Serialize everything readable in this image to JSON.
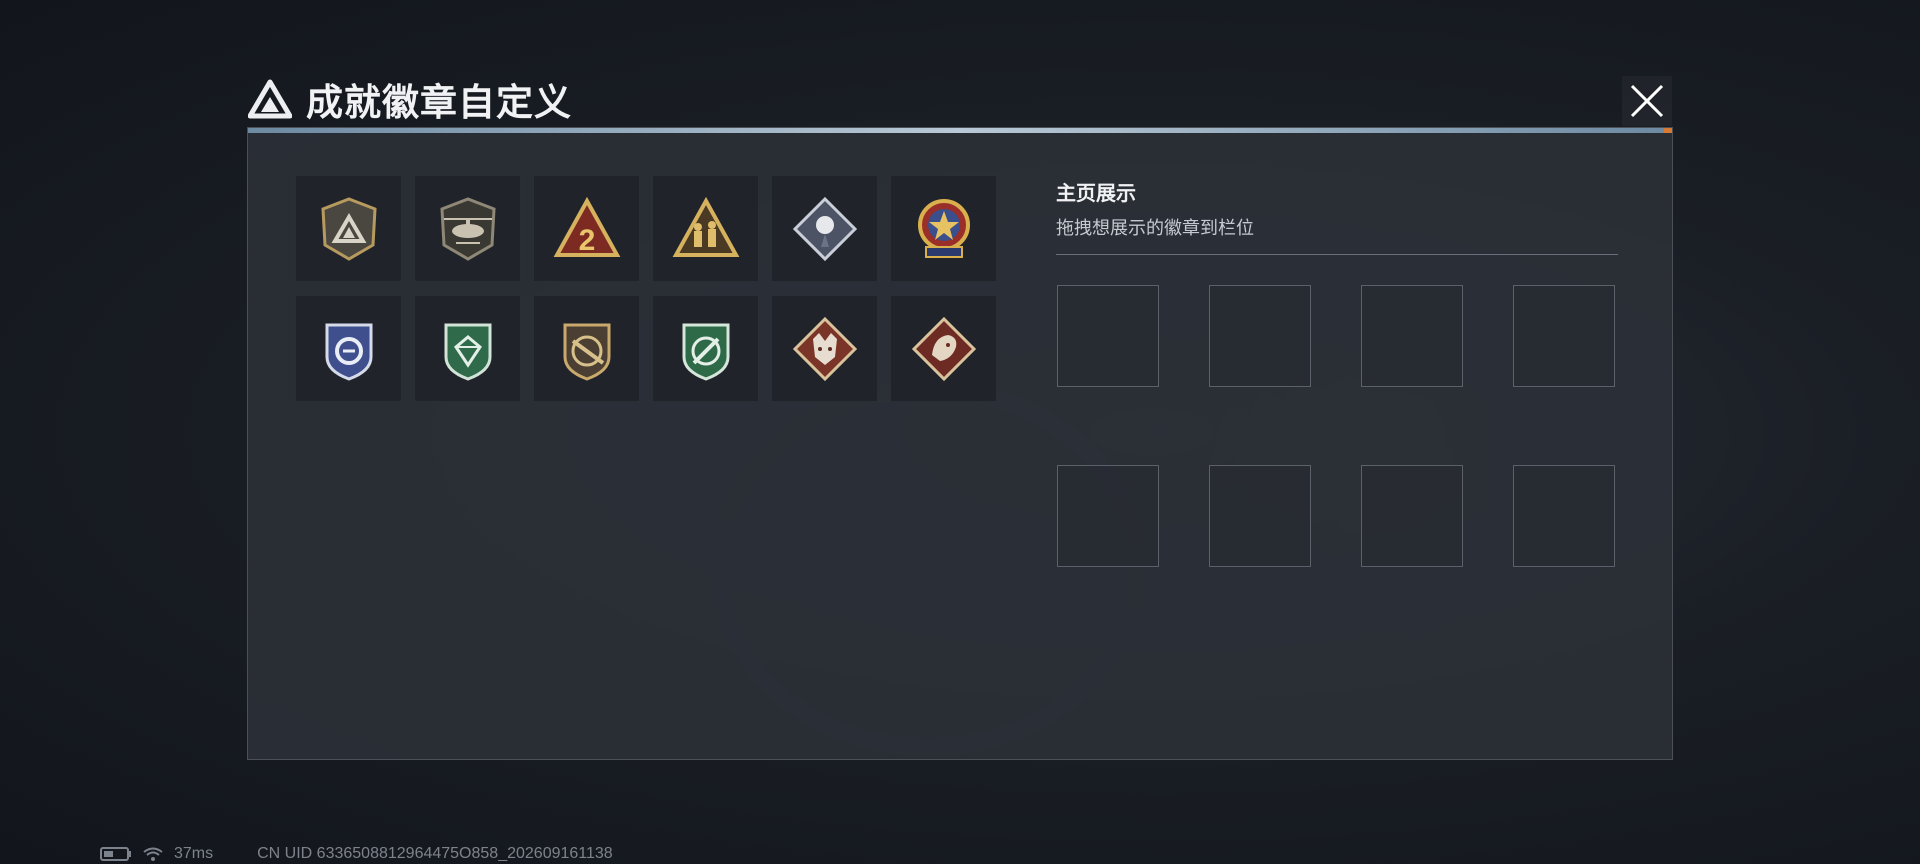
{
  "title": "成就徽章自定义",
  "close_icon": "close-icon",
  "showcase": {
    "heading": "主页展示",
    "hint": "拖拽想展示的徽章到栏位",
    "slot_count": 8
  },
  "badges": [
    {
      "icon": "shield-triangle-badge-icon"
    },
    {
      "icon": "helicopter-badge-icon"
    },
    {
      "icon": "number-two-triangle-badge-icon"
    },
    {
      "icon": "soldiers-triangle-badge-icon"
    },
    {
      "icon": "rose-diamond-badge-icon"
    },
    {
      "icon": "star-ribbon-badge-icon"
    },
    {
      "icon": "blue-wing-shield-badge-icon"
    },
    {
      "icon": "green-gem-shield-badge-icon"
    },
    {
      "icon": "rifle-shield-badge-icon"
    },
    {
      "icon": "knife-crosshair-badge-icon"
    },
    {
      "icon": "wolf-diamond-badge-icon"
    },
    {
      "icon": "dragon-diamond-badge-icon"
    }
  ],
  "status": {
    "ping": "37ms",
    "uid": "CN UID 6336508812964475O858_202609161138"
  },
  "colors": {
    "panel": "#2b2f37",
    "accent_line": "#b9c9d6",
    "accent_orange": "#d97a32"
  }
}
